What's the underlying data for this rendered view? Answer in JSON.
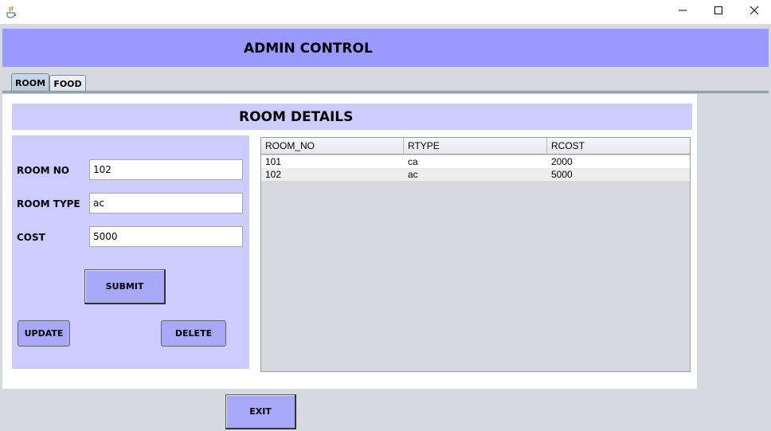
{
  "window": {
    "controls": {
      "minimize_icon": "minimize-icon",
      "maximize_icon": "maximize-icon",
      "close_icon": "close-icon"
    }
  },
  "header": {
    "title": "ADMIN CONTROL"
  },
  "tabs": [
    {
      "label": "ROOM",
      "selected": true
    },
    {
      "label": "FOOD",
      "selected": false
    }
  ],
  "room_details": {
    "title": "ROOM DETAILS",
    "form": {
      "room_no_label": "ROOM NO",
      "room_no_value": "102",
      "room_type_label": "ROOM TYPE",
      "room_type_value": "ac",
      "cost_label": "COST",
      "cost_value": "5000"
    },
    "buttons": {
      "submit": "SUBMIT",
      "update": "UPDATE",
      "delete": "DELETE"
    },
    "table": {
      "columns": [
        "ROOM_NO",
        "RTYPE",
        "RCOST"
      ],
      "rows": [
        [
          "101",
          "ca",
          "2000"
        ],
        [
          "102",
          "ac",
          "5000"
        ]
      ]
    }
  },
  "footer": {
    "exit": "EXIT"
  },
  "colors": {
    "header_band": "#9999ff",
    "panel_light": "#ccccff",
    "button": "#a8a8f8",
    "background": "#d6d9df"
  }
}
